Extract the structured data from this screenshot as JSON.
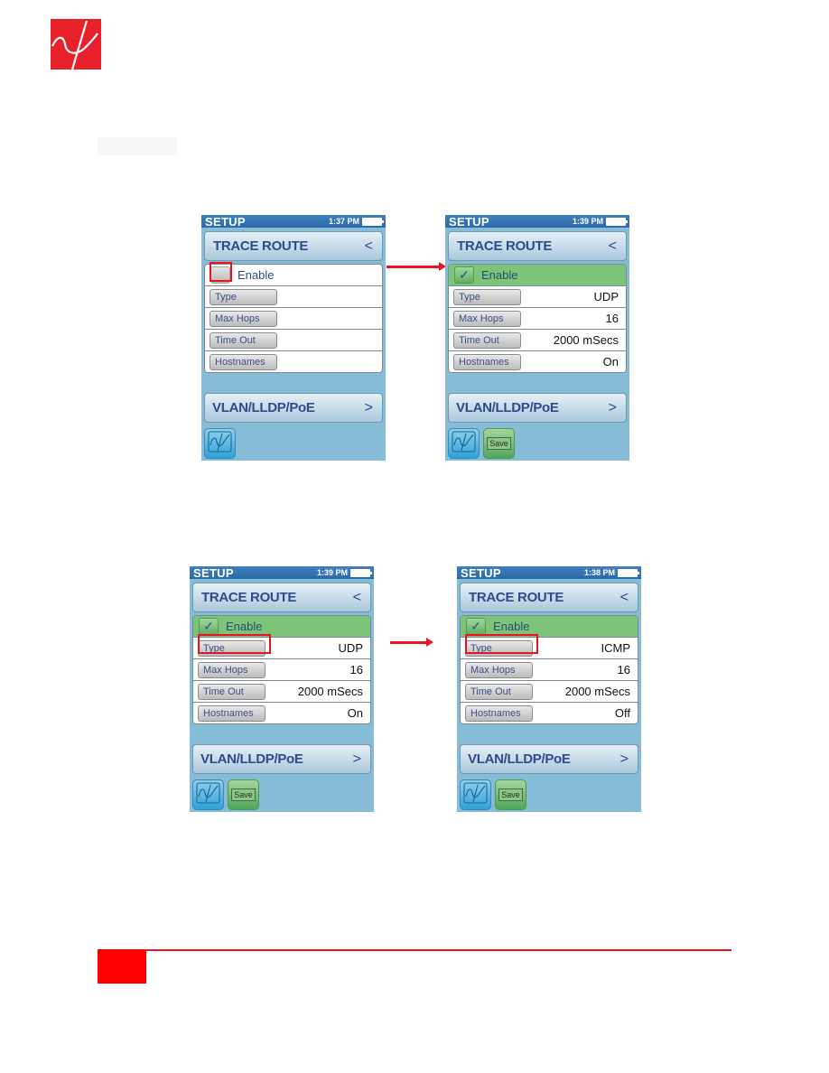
{
  "page": {
    "brand_color": "#e8202a",
    "accent_red": "#e5141e",
    "logo_icon": "psi-logo-icon"
  },
  "screens": [
    {
      "status": {
        "title": "SETUP",
        "time": "1:37 PM",
        "battery_icon": "battery-icon"
      },
      "section": {
        "label": "TRACE ROUTE",
        "chevron": "<"
      },
      "enable": {
        "label": "Enable",
        "checked": false,
        "check_glyph": ""
      },
      "rows": [
        {
          "label": "Type",
          "value": ""
        },
        {
          "label": "Max Hops",
          "value": ""
        },
        {
          "label": "Time Out",
          "value": ""
        },
        {
          "label": "Hostnames",
          "value": ""
        }
      ],
      "next_section": {
        "label": "VLAN/LLDP/PoE",
        "chevron": ">"
      },
      "buttons": {
        "home_icon": "scope-logo-icon",
        "save_label": null
      },
      "highlight": "enable-checkbox"
    },
    {
      "status": {
        "title": "SETUP",
        "time": "1:39 PM",
        "battery_icon": "battery-icon"
      },
      "section": {
        "label": "TRACE ROUTE",
        "chevron": "<"
      },
      "enable": {
        "label": "Enable",
        "checked": true,
        "check_glyph": "✓"
      },
      "rows": [
        {
          "label": "Type",
          "value": "UDP"
        },
        {
          "label": "Max Hops",
          "value": "16"
        },
        {
          "label": "Time Out",
          "value": "2000 mSecs"
        },
        {
          "label": "Hostnames",
          "value": "On"
        }
      ],
      "next_section": {
        "label": "VLAN/LLDP/PoE",
        "chevron": ">"
      },
      "buttons": {
        "home_icon": "scope-logo-icon",
        "save_label": "Save"
      },
      "highlight": null
    },
    {
      "status": {
        "title": "SETUP",
        "time": "1:39 PM",
        "battery_icon": "battery-icon"
      },
      "section": {
        "label": "TRACE ROUTE",
        "chevron": "<"
      },
      "enable": {
        "label": "Enable",
        "checked": true,
        "check_glyph": "✓"
      },
      "rows": [
        {
          "label": "Type",
          "value": "UDP"
        },
        {
          "label": "Max Hops",
          "value": "16"
        },
        {
          "label": "Time Out",
          "value": "2000 mSecs"
        },
        {
          "label": "Hostnames",
          "value": "On"
        }
      ],
      "next_section": {
        "label": "VLAN/LLDP/PoE",
        "chevron": ">"
      },
      "buttons": {
        "home_icon": "scope-logo-icon",
        "save_label": "Save"
      },
      "highlight": "type-button"
    },
    {
      "status": {
        "title": "SETUP",
        "time": "1:38 PM",
        "battery_icon": "battery-icon"
      },
      "section": {
        "label": "TRACE ROUTE",
        "chevron": "<"
      },
      "enable": {
        "label": "Enable",
        "checked": true,
        "check_glyph": "✓"
      },
      "rows": [
        {
          "label": "Type",
          "value": "ICMP"
        },
        {
          "label": "Max Hops",
          "value": "16"
        },
        {
          "label": "Time Out",
          "value": "2000 mSecs"
        },
        {
          "label": "Hostnames",
          "value": "Off"
        }
      ],
      "next_section": {
        "label": "VLAN/LLDP/PoE",
        "chevron": ">"
      },
      "buttons": {
        "home_icon": "scope-logo-icon",
        "save_label": "Save"
      },
      "highlight": "type-button"
    }
  ]
}
